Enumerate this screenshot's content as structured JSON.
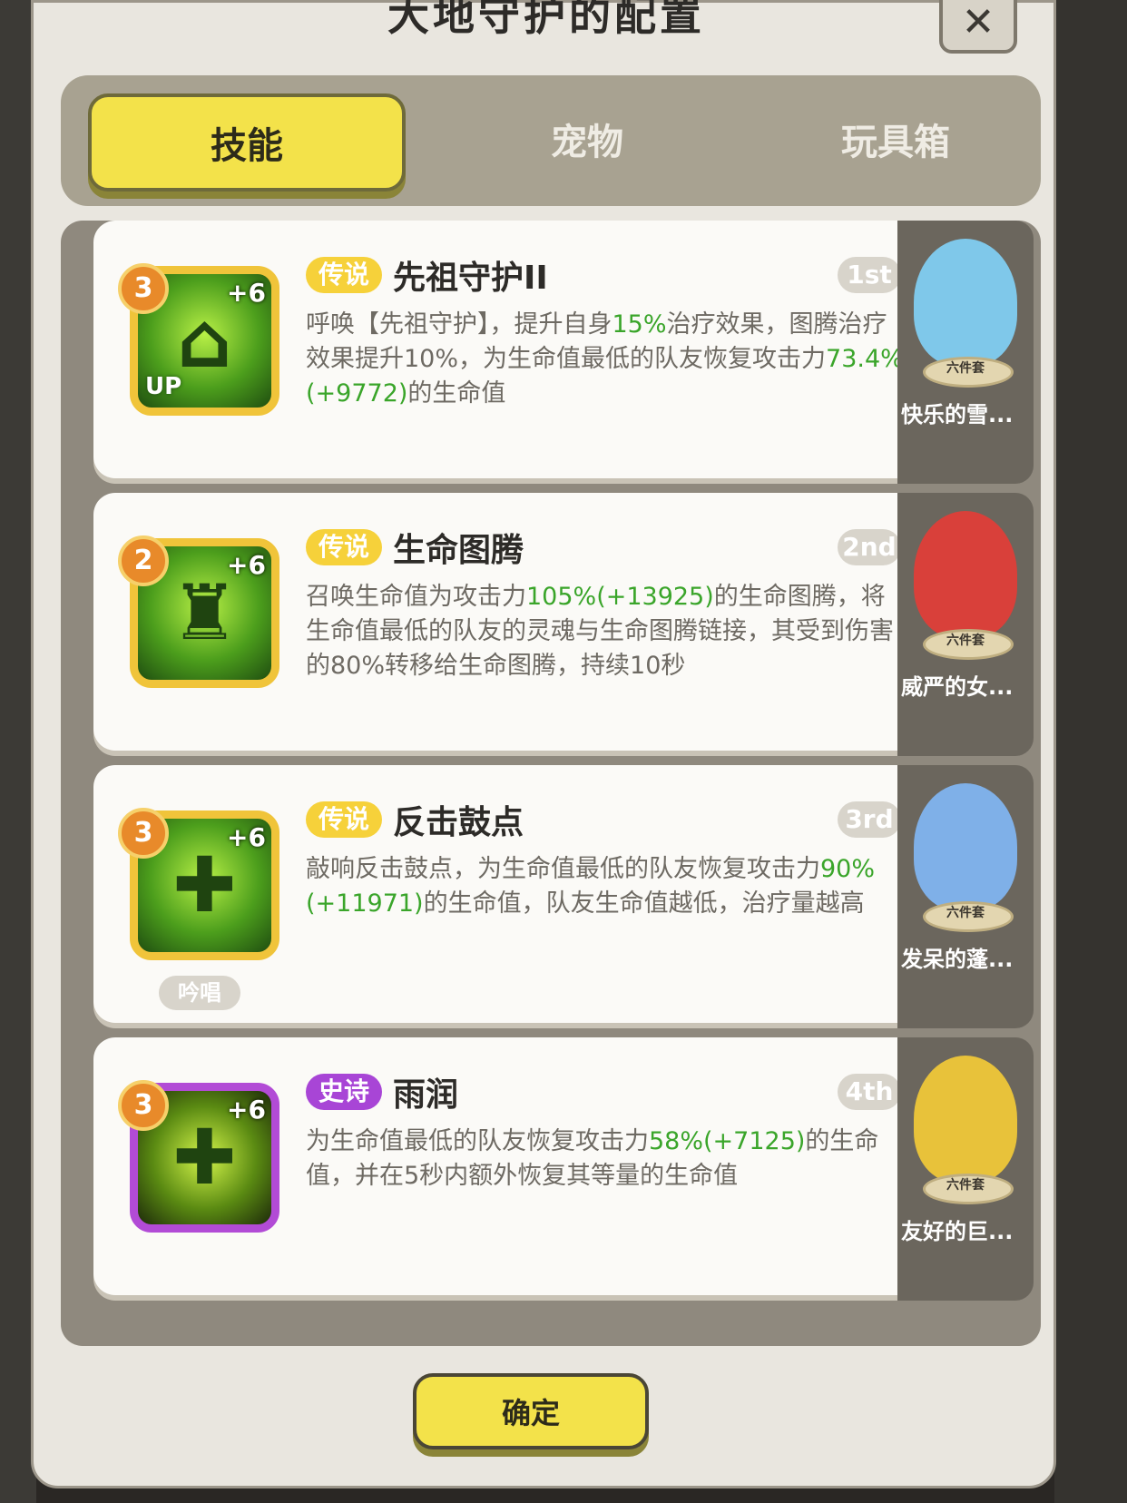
{
  "header": {
    "title": "大地守护的配置",
    "close_icon": "✕"
  },
  "tabs": [
    {
      "label": "技能",
      "active": true
    },
    {
      "label": "宠物",
      "active": false
    },
    {
      "label": "玩具箱",
      "active": false
    }
  ],
  "skills": [
    {
      "level": "3",
      "bonus": "+6",
      "up": "UP",
      "rarity": "传说",
      "name": "先祖守护II",
      "rank": "1st",
      "desc_before": "呼唤【先祖守护】，提升自身",
      "hl1": "15%",
      "desc_mid": "治疗效果，图腾治疗效果提升10%，为生命值最低的队友恢复攻击力",
      "hl2": "73.4%(+9772)",
      "desc_after": "的生命值",
      "pet": {
        "set": "六件套",
        "name": "快乐的雪...",
        "color": "#7fc8ea"
      }
    },
    {
      "level": "2",
      "bonus": "+6",
      "rarity": "传说",
      "name": "生命图腾",
      "rank": "2nd",
      "desc_before": "召唤生命值为攻击力",
      "hl1": "105%(+13925)",
      "desc_mid": "的生命图腾，将生命值最低的队友的灵魂与生命图腾链接，其受到伤害的80%转移给生命图腾，持续10秒",
      "hl2": "",
      "desc_after": "",
      "pet": {
        "set": "六件套",
        "name": "威严的女...",
        "color": "#d9403a"
      }
    },
    {
      "level": "3",
      "bonus": "+6",
      "cast": "吟唱",
      "rarity": "传说",
      "name": "反击鼓点",
      "rank": "3rd",
      "desc_before": "敲响反击鼓点，为生命值最低的队友恢复攻击力",
      "hl1": "90%(+11971)",
      "desc_mid": "的生命值，队友生命值越低，治疗量越高",
      "hl2": "",
      "desc_after": "",
      "pet": {
        "set": "六件套",
        "name": "发呆的蓬...",
        "color": "#7fb0e8"
      }
    },
    {
      "level": "3",
      "bonus": "+6",
      "rarity": "史诗",
      "name": "雨润",
      "rank": "4th",
      "desc_before": "为生命值最低的队友恢复攻击力",
      "hl1": "58%(+7125)",
      "desc_mid": "的生命值，并在5秒内额外恢复其等量的生命值",
      "hl2": "",
      "desc_after": "",
      "pet": {
        "set": "六件套",
        "name": "友好的巨...",
        "color": "#e8c23a"
      }
    }
  ],
  "footer": {
    "confirm_label": "确定"
  }
}
